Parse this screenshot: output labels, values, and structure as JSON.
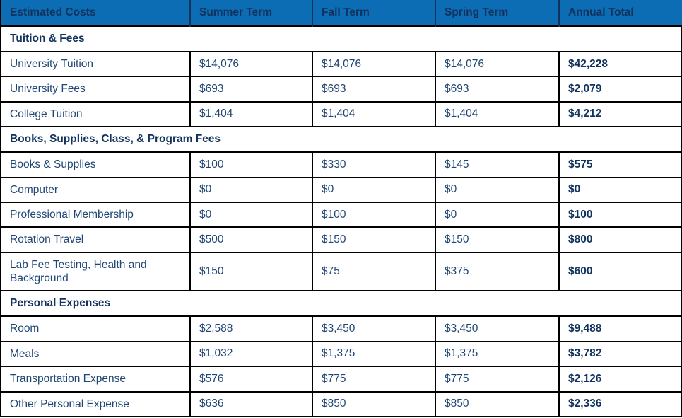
{
  "table": {
    "columns": [
      {
        "key": "label",
        "label": "Estimated Costs"
      },
      {
        "key": "summer",
        "label": "Summer Term"
      },
      {
        "key": "fall",
        "label": "Fall Term"
      },
      {
        "key": "spring",
        "label": "Spring Term"
      },
      {
        "key": "total",
        "label": "Annual Total"
      }
    ],
    "colors": {
      "header_background": "#0c6cb4",
      "header_text": "#11325c",
      "body_text": "#1f4674",
      "total_text": "#11325c",
      "border": "#000000",
      "page_background": "#ffffff"
    },
    "sections": [
      {
        "title": "Tuition & Fees",
        "rows": [
          {
            "label": "University Tuition",
            "summer": "$14,076",
            "fall": "$14,076",
            "spring": "$14,076",
            "total": "$42,228"
          },
          {
            "label": "University Fees",
            "summer": "$693",
            "fall": "$693",
            "spring": "$693",
            "total": "$2,079"
          },
          {
            "label": "College Tuition",
            "summer": "$1,404",
            "fall": "$1,404",
            "spring": "$1,404",
            "total": "$4,212"
          }
        ]
      },
      {
        "title": "Books, Supplies, Class, & Program Fees",
        "rows": [
          {
            "label": "Books & Supplies",
            "summer": "$100",
            "fall": "$330",
            "spring": "$145",
            "total": "$575"
          },
          {
            "label": "Computer",
            "summer": "$0",
            "fall": "$0",
            "spring": "$0",
            "total": "$0"
          },
          {
            "label": "Professional Membership",
            "summer": "$0",
            "fall": "$100",
            "spring": "$0",
            "total": "$100"
          },
          {
            "label": "Rotation Travel",
            "summer": "$500",
            "fall": "$150",
            "spring": "$150",
            "total": "$800"
          },
          {
            "label": "Lab Fee Testing, Health and Background",
            "summer": "$150",
            "fall": "$75",
            "spring": "$375",
            "total": "$600"
          }
        ]
      },
      {
        "title": "Personal Expenses",
        "rows": [
          {
            "label": "Room",
            "summer": "$2,588",
            "fall": "$3,450",
            "spring": "$3,450",
            "total": "$9,488"
          },
          {
            "label": "Meals",
            "summer": "$1,032",
            "fall": "$1,375",
            "spring": "$1,375",
            "total": "$3,782"
          },
          {
            "label": "Transportation Expense",
            "summer": "$576",
            "fall": "$775",
            "spring": "$775",
            "total": "$2,126"
          },
          {
            "label": "Other Personal Expense",
            "summer": "$636",
            "fall": "$850",
            "spring": "$850",
            "total": "$2,336"
          }
        ]
      }
    ]
  }
}
